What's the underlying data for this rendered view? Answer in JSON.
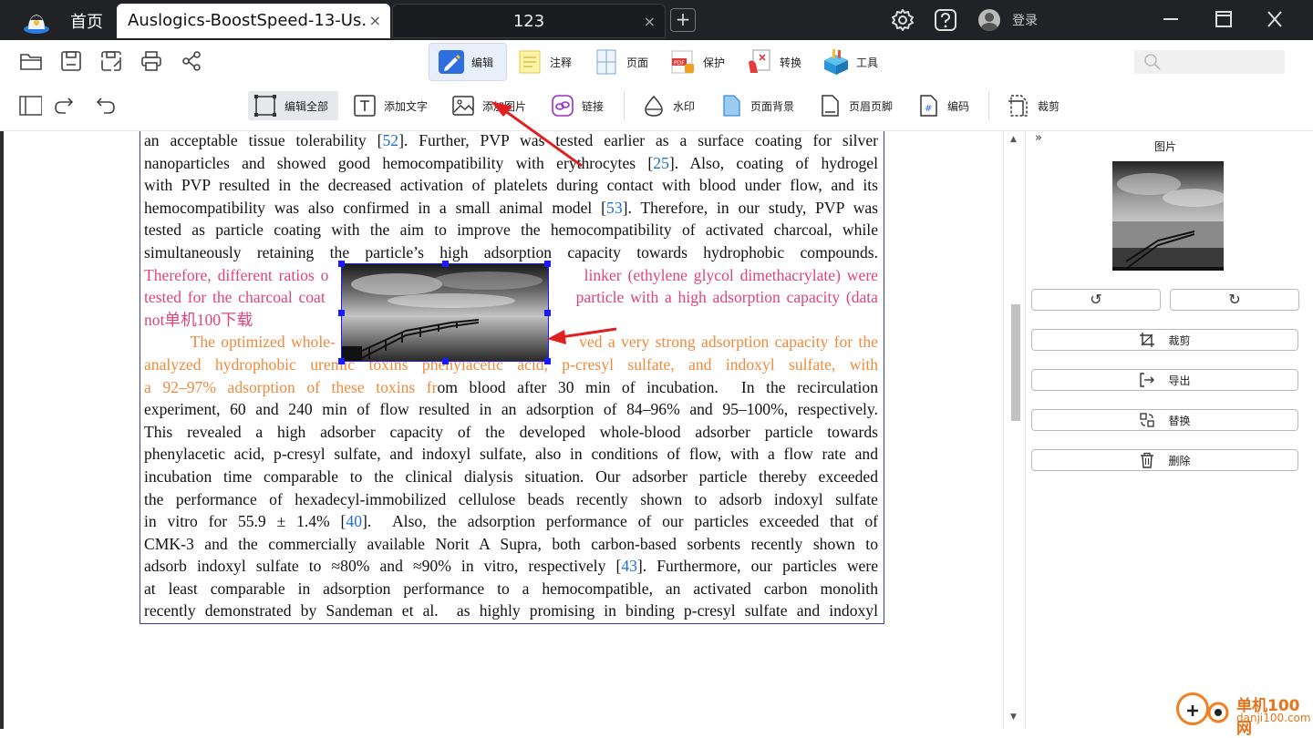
{
  "titlebar": {
    "home_tab": "首页",
    "tabs": [
      {
        "label": "Auslogics-BoostSpeed-13-Us...",
        "active": true
      },
      {
        "label": "123",
        "active": false
      }
    ],
    "close_glyph": "×",
    "new_tab_glyph": "+",
    "login": "登录",
    "icons": [
      "settings-icon",
      "help-icon",
      "avatar"
    ],
    "window_controls": [
      "minimize",
      "maximize",
      "close"
    ]
  },
  "ribbon": {
    "tabs": [
      {
        "label": "编辑",
        "active": true
      },
      {
        "label": "注释"
      },
      {
        "label": "页面"
      },
      {
        "label": "保护"
      },
      {
        "label": "转换"
      },
      {
        "label": "工具"
      }
    ]
  },
  "edit_toolbar": {
    "items": [
      {
        "label": "编辑全部",
        "active": true
      },
      {
        "label": "添加文字"
      },
      {
        "label": "添加图片"
      },
      {
        "label": "链接"
      },
      {
        "label": "水印"
      },
      {
        "label": "页面背景"
      },
      {
        "label": "页眉页脚"
      },
      {
        "label": "编码"
      },
      {
        "label": "裁剪"
      }
    ]
  },
  "document": {
    "lines": [
      [
        {
          "t": "an acceptable tissue tolerability ["
        },
        {
          "t": "52",
          "c": "ref"
        },
        {
          "t": "]. Further, PVP was tested earlier as a surface coating for silver"
        }
      ],
      [
        {
          "t": "nanoparticles and showed good hemocompatibility with erythrocytes ["
        },
        {
          "t": "25",
          "c": "ref"
        },
        {
          "t": "]. Also, coating of hydrogel"
        }
      ],
      [
        {
          "t": "with PVP resulted in the decreased activation of platelets during contact with blood under flow, and its"
        }
      ],
      [
        {
          "t": "hemocompatibility was also confirmed in a small animal model ["
        },
        {
          "t": "53",
          "c": "ref"
        },
        {
          "t": "]. Therefore, in our study, PVP was"
        }
      ],
      [
        {
          "t": "tested as particle coating with the aim to improve the hemocompatibility of activated charcoal, while"
        }
      ],
      [
        {
          "t": "simultaneously retaining the particle’s high adsorption capacity towards hydrophobic compounds."
        }
      ],
      [
        {
          "t": "Therefore, different ratios o                                         linker (ethylene glycol dimethacrylate) were",
          "c": "pink"
        }
      ],
      [
        {
          "t": "tested for the charcoal coat                                         particle with a high adsorption capacity (data",
          "c": "pink"
        }
      ],
      [
        {
          "t": "not单机100下载",
          "c": "pink"
        }
      ],
      [
        {
          "t": "        The optimized whole-                                          ved a very strong adsorption capacity for the",
          "c": "orange"
        }
      ],
      [
        {
          "t": "analyzed hydrophobic uremic toxins phenylacetic acid, p-cresyl sulfate, and indoxyl sulfate, with",
          "c": "orange"
        }
      ],
      [
        {
          "t": "a 92–97% adsorption of these toxins fr",
          "c": "orange"
        },
        {
          "t": "om blood after 30 min of incubation.  In the recirculation"
        }
      ],
      [
        {
          "t": "experiment, 60 and 240 min of flow resulted in an adsorption of 84–96% and 95–100%, respectively."
        }
      ],
      [
        {
          "t": "This revealed a high adsorber capacity of the developed whole-blood adsorber particle towards"
        }
      ],
      [
        {
          "t": "phenylacetic acid, p-cresyl sulfate, and indoxyl sulfate, also in conditions of flow, with a flow rate and"
        }
      ],
      [
        {
          "t": "incubation time comparable to the clinical dialysis situation. Our adsorber particle thereby exceeded"
        }
      ],
      [
        {
          "t": "the performance of hexadecyl-immobilized cellulose beads recently shown to adsorb indoxyl sulfate"
        }
      ],
      [
        {
          "t": "in vitro for 55.9 ± 1.4% ["
        },
        {
          "t": "40",
          "c": "ref"
        },
        {
          "t": "].  Also, the adsorption performance of our particles exceeded that of"
        }
      ],
      [
        {
          "t": "CMK-3 and the commercially available Norit A Supra, both carbon-based sorbents recently shown to"
        }
      ],
      [
        {
          "t": "adsorb indoxyl sulfate to ≈80% and ≈90% in vitro, respectively ["
        },
        {
          "t": "43",
          "c": "ref"
        },
        {
          "t": "]. Furthermore, our particles were"
        }
      ],
      [
        {
          "t": "at least comparable in adsorption performance to a hemocompatible, an activated carbon monolith"
        }
      ],
      [
        {
          "t": "recently demonstrated by Sandeman et al.  as highly promising in binding p-cresyl sulfate and indoxyl"
        }
      ]
    ]
  },
  "panel": {
    "collapse": "»",
    "title": "图片",
    "rotate_left": "↺",
    "rotate_right": "↻",
    "buttons": [
      {
        "label": "裁剪",
        "icon": "crop-icon"
      },
      {
        "label": "导出",
        "icon": "export-icon"
      },
      {
        "label": "替换",
        "icon": "replace-icon"
      },
      {
        "label": "删除",
        "icon": "delete-icon"
      }
    ]
  },
  "watermark": {
    "line1": "单机100网",
    "line2": "danji100.com"
  },
  "colors": {
    "accent": "#2f6ee0",
    "pink_text": "#e0447d",
    "orange_text": "#f08a3c",
    "link": "#1f6fd0",
    "selection": "#1a1aff",
    "arrow": "#e02020"
  }
}
